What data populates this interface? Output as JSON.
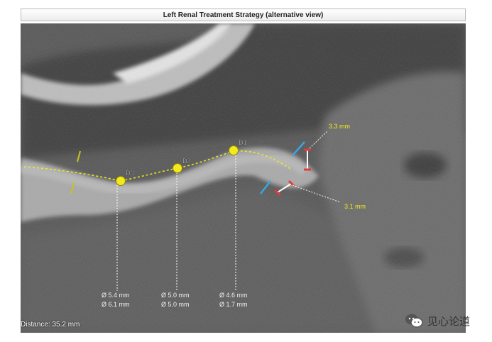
{
  "window": {
    "title": "Left Renal Treatment Strategy (alternative view)"
  },
  "markers": [
    {
      "label": "D3",
      "diameter_1": "Ø 5.4 mm",
      "diameter_2": "Ø 6.1 mm"
    },
    {
      "label": "D2",
      "diameter_1": "Ø 5.0 mm",
      "diameter_2": "Ø 5.0 mm"
    },
    {
      "label": "D1",
      "diameter_1": "Ø 4.6 mm",
      "diameter_2": "Ø 1.7 mm"
    }
  ],
  "calipers": [
    {
      "label": "3.3 mm"
    },
    {
      "label": "3.1 mm"
    }
  ],
  "status": {
    "distance": "Distance: 35.2 mm"
  },
  "watermark": {
    "text": "见心论道"
  },
  "colors": {
    "marker": "#f2ea1c",
    "caliper": "#e23b3b",
    "cut_line": "#3aa6e0"
  }
}
